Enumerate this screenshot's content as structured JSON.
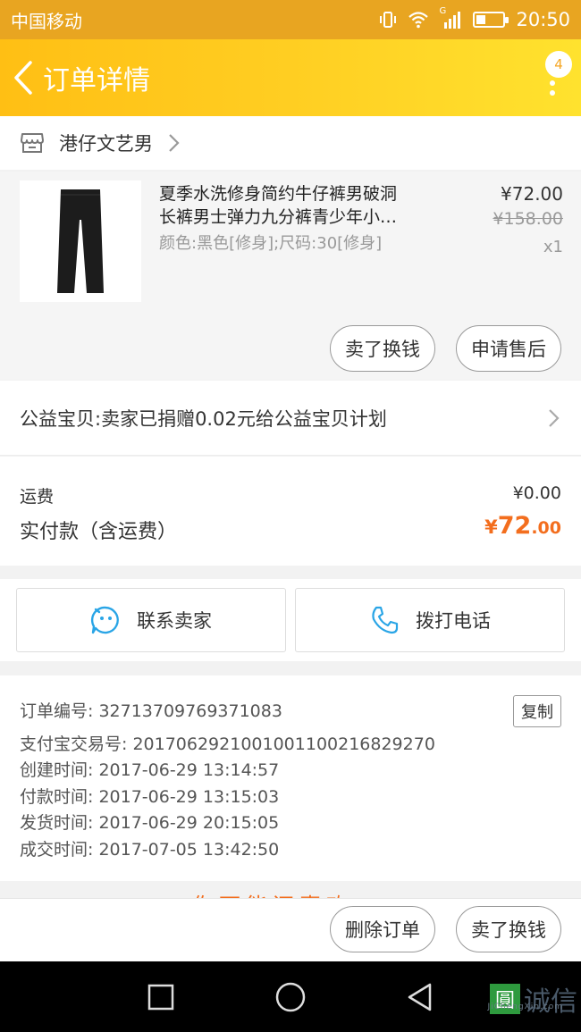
{
  "status_bar": {
    "carrier": "中国移动",
    "signal_tag": "G",
    "time": "20:50"
  },
  "nav": {
    "title": "订单详情",
    "badge_count": "4"
  },
  "shop": {
    "name": "港仔文艺男"
  },
  "product": {
    "title_line1": "夏季水洗修身简约牛仔裤男破洞",
    "title_line2": "长裤男士弹力九分裤青少年小…",
    "sku": "颜色:黑色[修身];尺码:30[修身]",
    "price": "¥72.00",
    "original_price": "¥158.00",
    "quantity": "x1",
    "resell_label": "卖了换钱",
    "after_sale_label": "申请售后"
  },
  "charity": {
    "text": "公益宝贝:卖家已捐赠0.02元给公益宝贝计划"
  },
  "totals": {
    "shipping_label": "运费",
    "shipping_value": "¥0.00",
    "paid_label": "实付款（含运费）",
    "paid_currency": "¥",
    "paid_int": "72",
    "paid_dec": ".00"
  },
  "contact": {
    "seller_label": "联系卖家",
    "call_label": "拨打电话"
  },
  "order_info": {
    "copy_label": "复制",
    "lines": [
      "订单编号: 32713709769371083",
      "支付宝交易号: 2017062921001001100216829270",
      "创建时间: 2017-06-29 13:14:57",
      "付款时间: 2017-06-29 13:15:03",
      "发货时间: 2017-06-29 20:15:05",
      "成交时间: 2017-07-05 13:42:50"
    ]
  },
  "peek_text": "你可能还喜欢",
  "bottom_actions": {
    "delete_label": "删除订单",
    "resell_label": "卖了换钱"
  },
  "watermark": {
    "mark": "圓",
    "text": "诚信",
    "sub": "JiChengXin.com"
  },
  "colors": {
    "accent": "#ffc61a",
    "price_orange": "#f36e1e",
    "contact_icon": "#2aa5e6"
  }
}
